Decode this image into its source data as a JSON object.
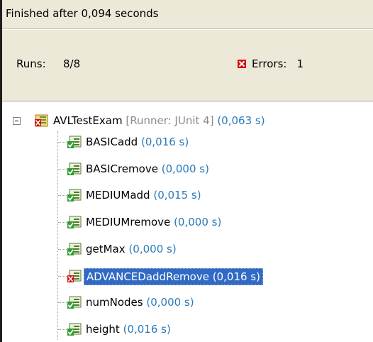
{
  "status": {
    "text": "Finished after 0,094 seconds"
  },
  "counters": {
    "runs_label": "Runs:",
    "runs_value": "8/8",
    "errors_label": "Errors:",
    "errors_value": "1"
  },
  "tree": {
    "root": {
      "name": "AVLTestExam",
      "runner": "[Runner: JUnit 4]",
      "time": "(0,063 s)",
      "status": "error"
    },
    "children": [
      {
        "name": "BASICadd",
        "time": "(0,016 s)",
        "status": "pass"
      },
      {
        "name": "BASICremove",
        "time": "(0,000 s)",
        "status": "pass"
      },
      {
        "name": "MEDIUMadd",
        "time": "(0,015 s)",
        "status": "pass"
      },
      {
        "name": "MEDIUMremove",
        "time": "(0,000 s)",
        "status": "pass"
      },
      {
        "name": "getMax",
        "time": "(0,000 s)",
        "status": "pass"
      },
      {
        "name": "ADVANCEDaddRemove",
        "time": "(0,016 s)",
        "status": "error",
        "selected": true
      },
      {
        "name": "numNodes",
        "time": "(0,000 s)",
        "status": "pass"
      },
      {
        "name": "height",
        "time": "(0,016 s)",
        "status": "pass"
      }
    ]
  },
  "colors": {
    "pass": "#2f9e2f",
    "error": "#d01010",
    "selection": "#316ac5",
    "time": "#2a7ab8"
  },
  "icons": {
    "root": "test-suite-error-icon",
    "pass": "test-pass-icon",
    "error": "test-error-icon",
    "counter_error": "error-icon"
  }
}
